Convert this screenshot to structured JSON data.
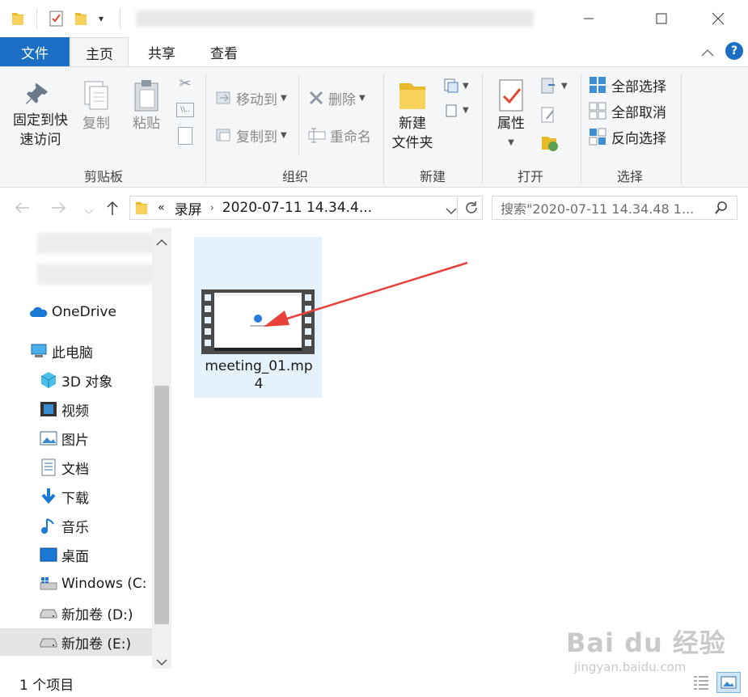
{
  "tabs": {
    "file": "文件",
    "home": "主页",
    "share": "共享",
    "view": "查看"
  },
  "ribbon": {
    "clipboard": {
      "label": "剪贴板",
      "pin_line1": "固定到快",
      "pin_line2": "速访问",
      "copy": "复制",
      "paste": "粘贴"
    },
    "organize": {
      "label": "组织",
      "move_to": "移动到",
      "copy_to": "复制到",
      "delete": "删除",
      "rename": "重命名"
    },
    "new": {
      "label": "新建",
      "new_folder_line1": "新建",
      "new_folder_line2": "文件夹"
    },
    "open": {
      "label": "打开",
      "properties": "属性"
    },
    "select": {
      "label": "选择",
      "select_all": "全部选择",
      "select_none": "全部取消",
      "invert": "反向选择"
    }
  },
  "address": {
    "overflow": "«",
    "crumb1": "录屏",
    "crumb2": "2020-07-11 14.34.4..."
  },
  "search": {
    "placeholder": "搜索\"2020-07-11 14.34.48 1..."
  },
  "nav": {
    "onedrive": "OneDrive",
    "thispc": "此电脑",
    "objects3d": "3D 对象",
    "videos": "视频",
    "pictures": "图片",
    "documents": "文档",
    "downloads": "下载",
    "music": "音乐",
    "desktop": "桌面",
    "c_drive": "Windows (C:",
    "d_drive": "新加卷 (D:)",
    "e_drive": "新加卷 (E:)"
  },
  "file": {
    "name_line1": "meeting_01.mp",
    "name_line2": "4"
  },
  "status": {
    "count": "1 个项目"
  },
  "watermark": {
    "brand": "Bai du 经验",
    "url": "jingyan.baidu.com"
  },
  "colors": {
    "accent": "#1a6fc4",
    "selection": "#e5f1fb",
    "arrow": "#e8413c"
  }
}
